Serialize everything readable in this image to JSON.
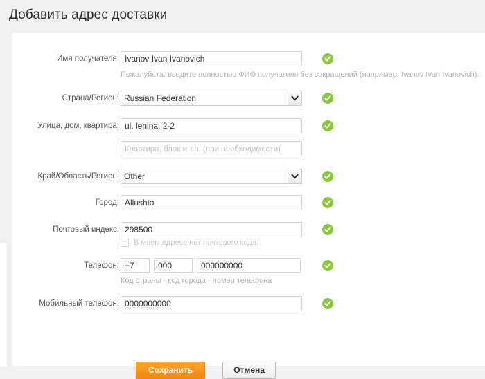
{
  "page": {
    "title": "Добавить адрес доставки",
    "background_color": "#f1f1f1",
    "card_color": "#ffffff"
  },
  "colors": {
    "accent_orange": "#f79420",
    "valid_green": "#8cc63e",
    "label_gray": "#555555",
    "hint_gray": "#b4b4b4"
  },
  "form": {
    "fields": [
      {
        "key": "recipient_name",
        "label": "Имя получателя:",
        "type": "text",
        "value": "Ivanov Ivan Ivanovich",
        "placeholder": "",
        "valid": true,
        "hint": "Пожалуйста, введите полностью ФИО получателя без сокращений (например: Ivanov Ivan Ivanovich)."
      },
      {
        "key": "country_region",
        "label": "Страна/Регион:",
        "type": "select",
        "value": "Russian Federation",
        "options": [
          "Russian Federation"
        ],
        "valid": true
      },
      {
        "key": "street_address",
        "label": "Улица, дом, квартира:",
        "type": "text",
        "value": "ul. lenina, 2-2",
        "placeholder": "",
        "valid": true
      },
      {
        "key": "address_line2",
        "label": "",
        "type": "text",
        "value": "",
        "placeholder": "Квартира, блок и т.п. (при необходимости)",
        "valid": false
      },
      {
        "key": "state_province",
        "label": "Край/Область/Регион:",
        "type": "select",
        "value": "Other",
        "options": [
          "Other"
        ],
        "valid": true
      },
      {
        "key": "city",
        "label": "Город:",
        "type": "text",
        "value": "Allushta",
        "placeholder": "",
        "valid": true
      },
      {
        "key": "postal_code",
        "label": "Почтовый индекс:",
        "type": "text",
        "value": "298500",
        "placeholder": "",
        "valid": true
      }
    ],
    "no_postal_code_checkbox": {
      "label": "В моём адресе нет почтового кода.",
      "checked": false
    },
    "phone": {
      "label": "Телефон:",
      "country_code": "+7",
      "area_code": "000",
      "number": "000000000",
      "valid": true,
      "hint": "Код страны - код города - номер телефона"
    },
    "mobile_phone": {
      "label": "Мобильный телефон:",
      "value": "0000000000",
      "valid": true
    }
  },
  "buttons": {
    "save": "Сохранить",
    "cancel": "Отмена"
  },
  "icons": {
    "valid_check": "check-circle-icon",
    "select_arrow": "chevron-down-icon"
  }
}
